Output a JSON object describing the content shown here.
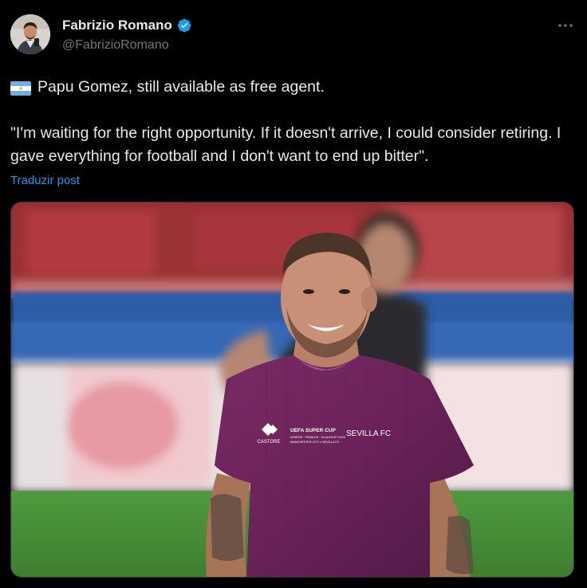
{
  "author": {
    "display_name": "Fabrizio Romano",
    "handle": "@FabrizioRomano",
    "verified": true,
    "verified_color": "#1d9bf0"
  },
  "actions": {
    "more_icon": "more-horizontal-icon"
  },
  "tweet": {
    "flag_icon": "argentina-flag-icon",
    "line1": "Papu Gomez, still available as free agent.",
    "quote": "\"I'm waiting for the right opportunity. If it doesn't arrive, I could consider retiring. I gave everything for football and I don't want to end up bitter\".",
    "translate_label": "Traduzir post"
  },
  "media": {
    "shirt_badge": "UEFA SUPER CUP",
    "shirt_badge_sub": "ATHENS · PIRAEUS · 16 AUGUST 2023",
    "shirt_badge_sub2": "MANCHESTER CITY v SEVILLA FC",
    "shirt_club": "SEVILLA FC",
    "shirt_brand": "CASTORE"
  },
  "colors": {
    "background": "#000000",
    "text": "#e7e9ea",
    "secondary": "#71767b",
    "link": "#1d9bf0"
  }
}
